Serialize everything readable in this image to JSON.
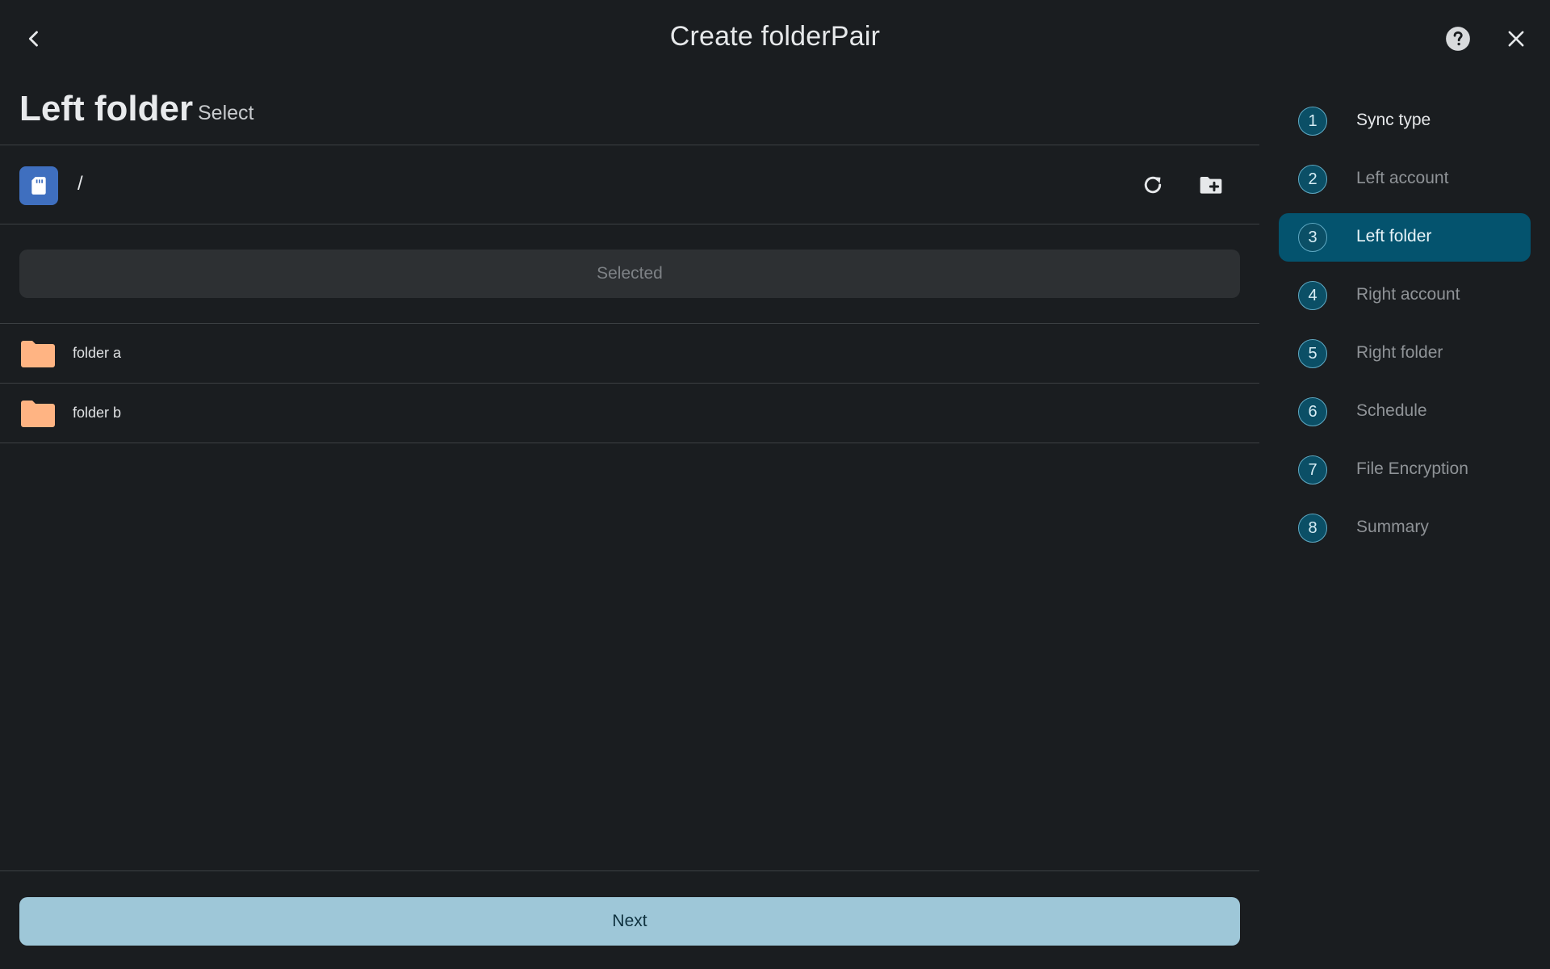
{
  "header": {
    "title": "Create folderPair",
    "back_icon": "chevron-left-icon",
    "help_icon": "help-circle-icon",
    "close_icon": "close-icon"
  },
  "section": {
    "title": "Left folder",
    "subtitle": "Select"
  },
  "path_bar": {
    "storage_icon": "sd-card-icon",
    "path": "/",
    "refresh_icon": "refresh-icon",
    "new_folder_icon": "create-folder-icon"
  },
  "selected_button": {
    "label": "Selected"
  },
  "folders": [
    {
      "name": "folder a"
    },
    {
      "name": "folder b"
    }
  ],
  "footer": {
    "next_label": "Next"
  },
  "steps": [
    {
      "number": "1",
      "label": "Sync type",
      "state": "done"
    },
    {
      "number": "2",
      "label": "Left account",
      "state": "pending"
    },
    {
      "number": "3",
      "label": "Left folder",
      "state": "active"
    },
    {
      "number": "4",
      "label": "Right account",
      "state": "pending"
    },
    {
      "number": "5",
      "label": "Right folder",
      "state": "pending"
    },
    {
      "number": "6",
      "label": "Schedule",
      "state": "pending"
    },
    {
      "number": "7",
      "label": "File Encryption",
      "state": "pending"
    },
    {
      "number": "8",
      "label": "Summary",
      "state": "pending"
    }
  ],
  "colors": {
    "background": "#1a1d20",
    "accent_active": "#04536e",
    "next_button": "#9ec7d8",
    "folder_icon": "#ffb483",
    "storage_icon": "#3f6fbf"
  }
}
